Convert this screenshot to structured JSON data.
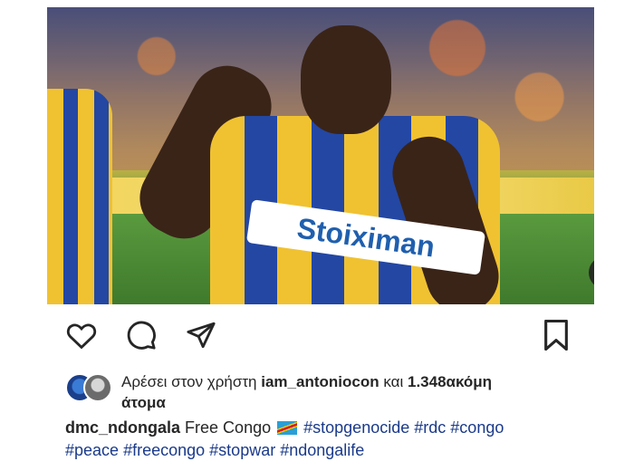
{
  "post": {
    "media": {
      "sponsor_text": "Stoiximan",
      "mute_icon": "muted-speaker-icon"
    },
    "actions": {
      "like_icon": "heart-icon",
      "comment_icon": "comment-icon",
      "share_icon": "send-icon",
      "save_icon": "bookmark-icon"
    },
    "likes": {
      "prefix": "Αρέσει στον χρήστη",
      "user": "iam_antoniocon",
      "connector": "και",
      "count_text": "1.348ακόμη",
      "suffix": "άτομα"
    },
    "caption": {
      "username": "dmc_ndongala",
      "text": "Free Congo",
      "flag_icon": "congo-flag-icon",
      "hashtags": [
        "#stopgenocide",
        "#rdc",
        "#congo",
        "#peace",
        "#freecongo",
        "#stopwar",
        "#ndongalife"
      ]
    }
  }
}
